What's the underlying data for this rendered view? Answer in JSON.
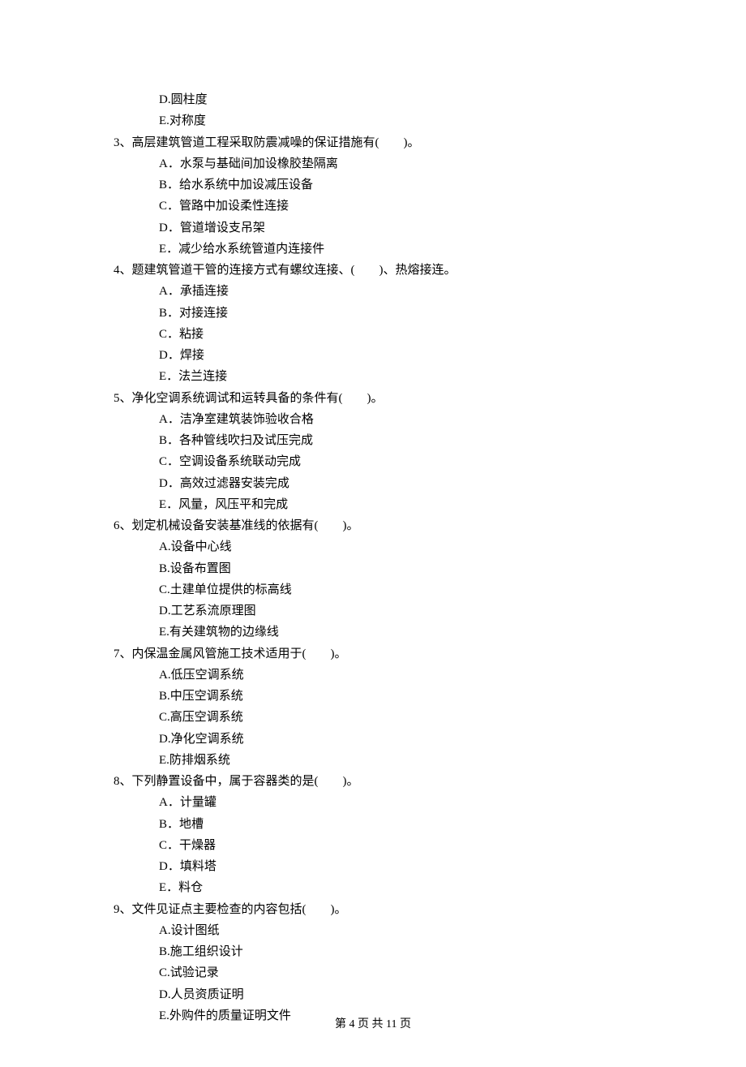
{
  "orphan_options": [
    {
      "key": "D.",
      "text": "圆柱度"
    },
    {
      "key": "E.",
      "text": "对称度"
    }
  ],
  "questions": [
    {
      "num": "3、",
      "stem": "高层建筑管道工程采取防震减噪的保证措施有(　　)。",
      "options": [
        {
          "key": "A．",
          "text": "水泵与基础间加设橡胶垫隔离"
        },
        {
          "key": "B．",
          "text": "给水系统中加设减压设备"
        },
        {
          "key": "C．",
          "text": "管路中加设柔性连接"
        },
        {
          "key": "D．",
          "text": "管道增设支吊架"
        },
        {
          "key": "E．",
          "text": "减少给水系统管道内连接件"
        }
      ]
    },
    {
      "num": "4、",
      "stem": "题建筑管道干管的连接方式有螺纹连接、(　　)、热熔接连。",
      "options": [
        {
          "key": "A．",
          "text": "承插连接"
        },
        {
          "key": "B．",
          "text": "对接连接"
        },
        {
          "key": "C．",
          "text": "粘接"
        },
        {
          "key": "D．",
          "text": "焊接"
        },
        {
          "key": "E．",
          "text": "法兰连接"
        }
      ]
    },
    {
      "num": "5、",
      "stem": "净化空调系统调试和运转具备的条件有(　　)。",
      "options": [
        {
          "key": "A．",
          "text": "洁净室建筑装饰验收合格"
        },
        {
          "key": "B．",
          "text": "各种管线吹扫及试压完成"
        },
        {
          "key": "C．",
          "text": "空调设备系统联动完成"
        },
        {
          "key": "D．",
          "text": "高效过滤器安装完成"
        },
        {
          "key": "E．",
          "text": "风量，风压平和完成"
        }
      ]
    },
    {
      "num": "6、",
      "stem": "划定机械设备安装基准线的依据有(　　)。",
      "options": [
        {
          "key": "A.",
          "text": "设备中心线"
        },
        {
          "key": "B.",
          "text": "设备布置图"
        },
        {
          "key": "C.",
          "text": "土建单位提供的标高线"
        },
        {
          "key": "D.",
          "text": "工艺系流原理图"
        },
        {
          "key": "E.",
          "text": "有关建筑物的边缘线"
        }
      ]
    },
    {
      "num": "7、",
      "stem": "内保温金属风管施工技术适用于(　　)。",
      "options": [
        {
          "key": "A.",
          "text": "低压空调系统"
        },
        {
          "key": "B.",
          "text": "中压空调系统"
        },
        {
          "key": "C.",
          "text": "高压空调系统"
        },
        {
          "key": "D.",
          "text": "净化空调系统"
        },
        {
          "key": "E.",
          "text": "防排烟系统"
        }
      ]
    },
    {
      "num": "8、",
      "stem": "下列静置设备中，属于容器类的是(　　)。",
      "options": [
        {
          "key": "A．",
          "text": "计量罐"
        },
        {
          "key": "B．",
          "text": "地槽"
        },
        {
          "key": "C．",
          "text": "干燥器"
        },
        {
          "key": "D．",
          "text": "填料塔"
        },
        {
          "key": "E．",
          "text": "料仓"
        }
      ]
    },
    {
      "num": "9、",
      "stem": "文件见证点主要检查的内容包括(　　)。",
      "options": [
        {
          "key": "A.",
          "text": "设计图纸"
        },
        {
          "key": "B.",
          "text": "施工组织设计"
        },
        {
          "key": "C.",
          "text": "试验记录"
        },
        {
          "key": "D.",
          "text": "人员资质证明"
        },
        {
          "key": "E.",
          "text": "外购件的质量证明文件"
        }
      ]
    }
  ],
  "footer": "第 4 页 共 11 页"
}
